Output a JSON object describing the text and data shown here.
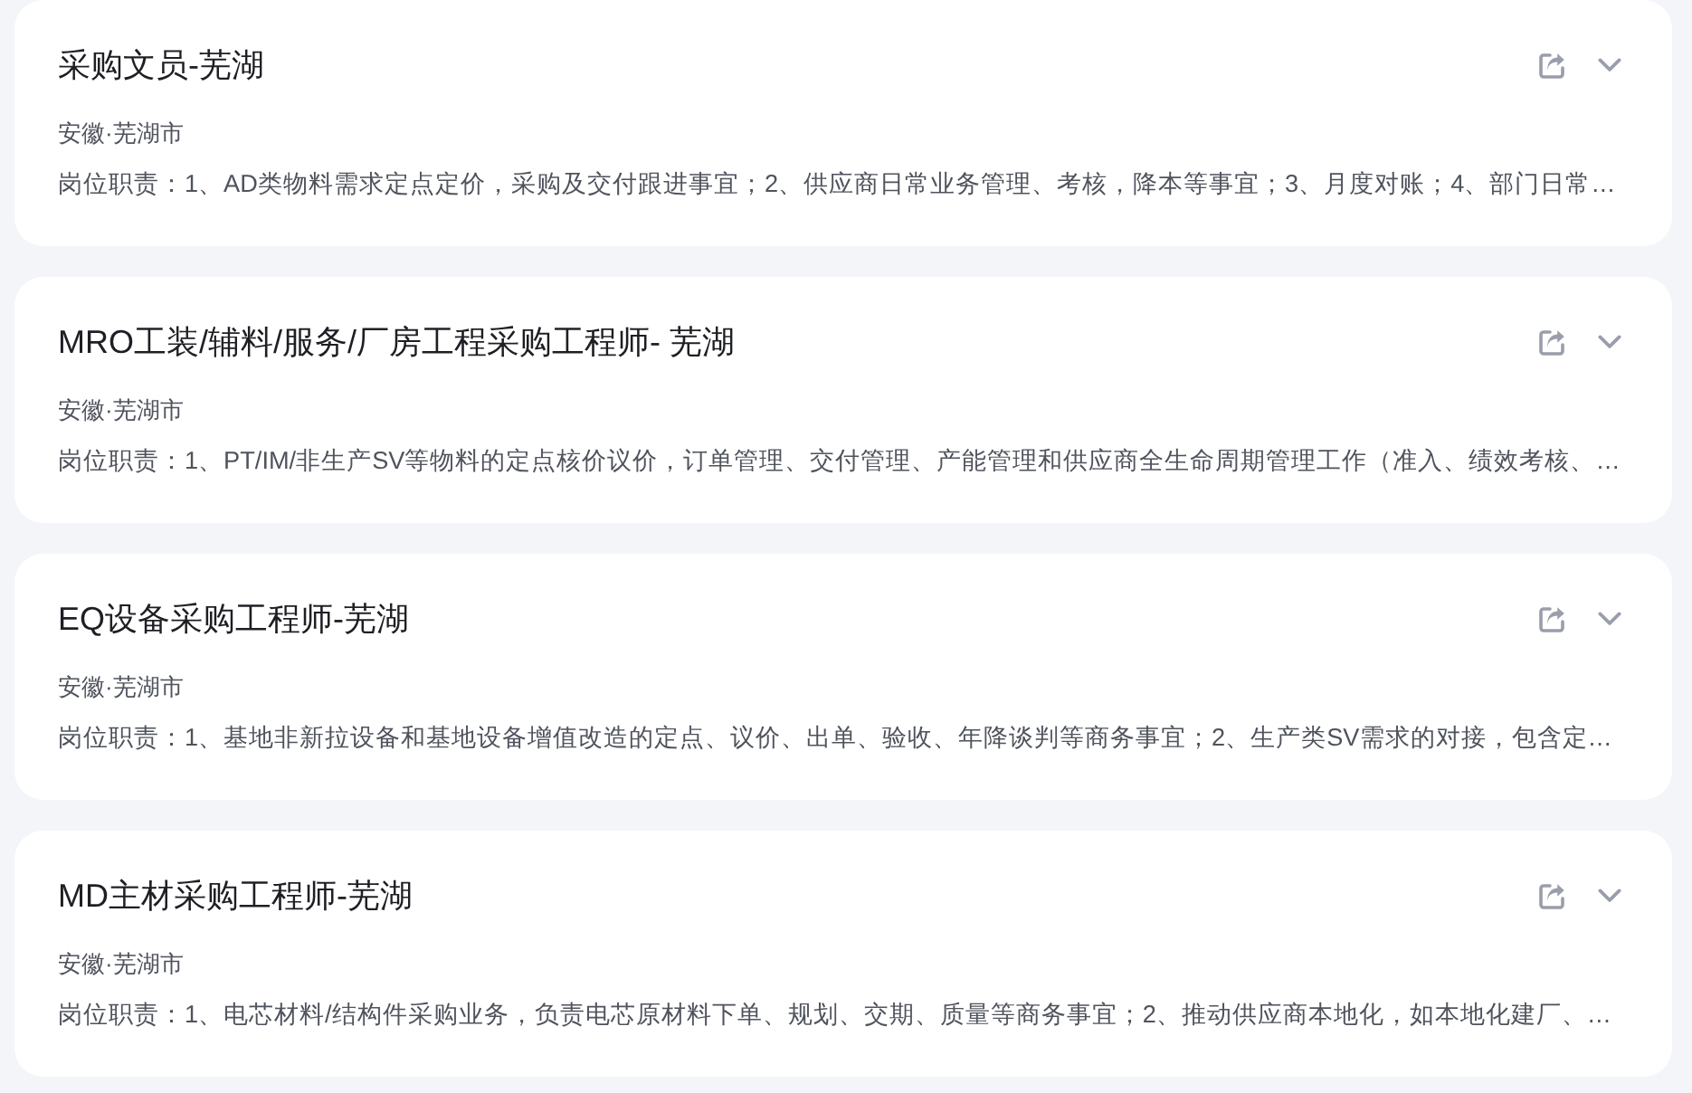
{
  "jobs": [
    {
      "title": "采购文员-芜湖",
      "location": "安徽·芜湖市",
      "description": "岗位职责：1、AD类物料需求定点定价，采购及交付跟进事宜；2、供应商日常业务管理、考核，降本等事宜；3、月度对账；4、部门日常…",
      "expanded": false
    },
    {
      "title": "MRO工装/辅料/服务/厂房工程采购工程师- 芜湖",
      "location": "安徽·芜湖市",
      "description": "岗位职责：1、PT/IM/非生产SV等物料的定点核价议价，订单管理、交付管理、产能管理和供应商全生命周期管理工作（准入、绩效考核、…",
      "expanded": false
    },
    {
      "title": "EQ设备采购工程师-芜湖",
      "location": "安徽·芜湖市",
      "description": "岗位职责：1、基地非新拉设备和基地设备增值改造的定点、议价、出单、验收、年降谈判等商务事宜；2、生产类SV需求的对接，包含定…",
      "expanded": false
    },
    {
      "title": "MD主材采购工程师-芜湖",
      "location": "安徽·芜湖市",
      "description": "岗位职责：1、电芯材料/结构件采购业务，负责电芯原材料下单、规划、交期、质量等商务事宜；2、推动供应商本地化，如本地化建厂、…",
      "expanded": false
    }
  ]
}
